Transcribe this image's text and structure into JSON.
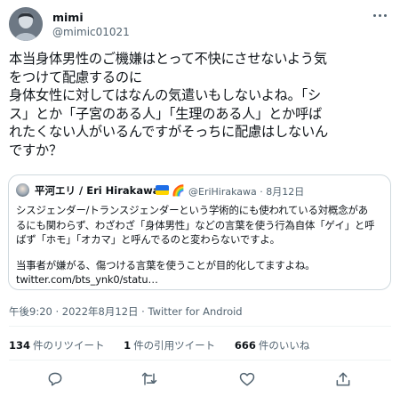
{
  "author": {
    "name": "mimi",
    "handle": "@mimic01021"
  },
  "tweet": {
    "lines": [
      "本当身体男性のご機嫌はとって不快にさせないよう気",
      "をつけて配慮するのに",
      "身体女性に対してはなんの気遣いもしないよね。「シ",
      "ス」とか「子宮のある人」「生理のある人」とか呼ば",
      "れたくない人がいるんですがそっちに配慮はしないん",
      "ですか？"
    ]
  },
  "quote": {
    "name": "平河エリ / Eri Hirakawa",
    "rainbow": "🌈",
    "handle_date": "@EriHirakawa · 8月12日",
    "lines": [
      "シスジェンダー/トランスジェンダーという学術的にも使われている対概念があ",
      "るにも関わらず、わざわざ「身体男性」などの言葉を使う行為自体「ゲイ」と呼",
      "ばず「ホモ」「オカマ」と呼んでるのと変わらないですよ。",
      "",
      "当事者が嫌がる、傷つける言葉を使うことが目的化してますよね。",
      "twitter.com/bts_ynk0/statu…"
    ]
  },
  "meta": {
    "timestamp": "午後9:20 · 2022年8月12日 · Twitter for Android"
  },
  "stats": {
    "retweets_count": "134",
    "retweets_label": "件のリツイート",
    "quotes_count": "1",
    "quotes_label": "件の引用ツイート",
    "likes_count": "666",
    "likes_label": "件のいいね"
  },
  "icons": [
    "more-icon",
    "reply-icon",
    "retweet-icon",
    "like-icon",
    "share-icon"
  ],
  "colors": {
    "text": "#0f1419",
    "secondary": "#536471",
    "border": "#cfd9de",
    "divider": "#eff3f4"
  }
}
